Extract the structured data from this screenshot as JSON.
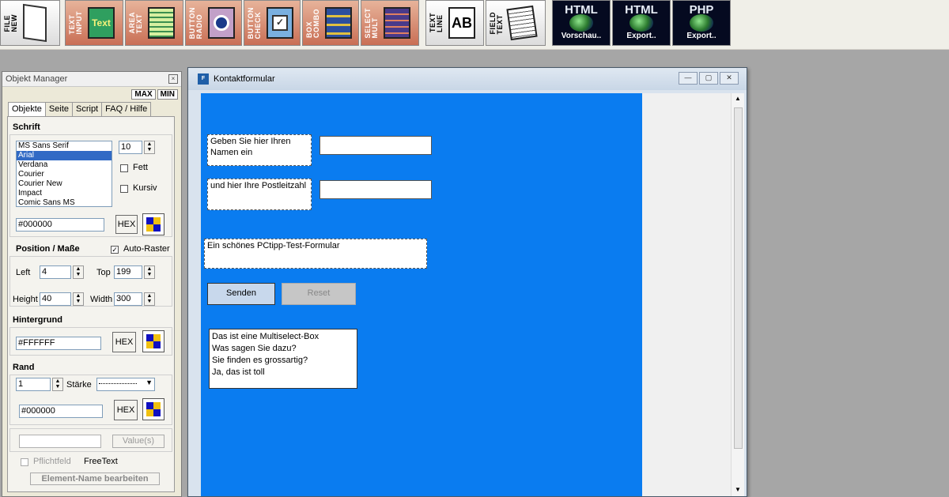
{
  "toolbar": {
    "buttons": [
      {
        "label": "FILE\nNEW",
        "icon": "file-new-icon"
      },
      {
        "label": "TEXT\nINPUT",
        "icon": "text-input-icon",
        "icon_text": "Text"
      },
      {
        "label": "AREA\nTEXT",
        "icon": "text-area-icon"
      },
      {
        "label": "BUTTON\nRADIO",
        "icon": "radio-button-icon"
      },
      {
        "label": "BUTTON\nCHECK",
        "icon": "checkbox-icon"
      },
      {
        "label": "BOX\nCOMBO",
        "icon": "combo-box-icon"
      },
      {
        "label": "SELECT\nMULT",
        "icon": "multi-select-icon"
      },
      {
        "label": "TEXT\nLINE",
        "icon": "text-line-icon",
        "icon_text": "AB"
      },
      {
        "label": "FIELD\nTEXT",
        "icon": "text-field-icon"
      }
    ],
    "actions": [
      {
        "big": "HTML",
        "small": "Vorschau..",
        "icon": "globe-icon"
      },
      {
        "big": "HTML",
        "small": "Export..",
        "icon": "globe-icon"
      },
      {
        "big": "PHP",
        "small": "Export..",
        "icon": "globe-icon"
      }
    ]
  },
  "objmgr": {
    "title": "Objekt Manager",
    "max": "MAX",
    "min": "MIN",
    "tabs": [
      "Objekte",
      "Seite",
      "Script",
      "FAQ / Hilfe"
    ],
    "font": {
      "heading": "Schrift",
      "list": [
        "MS Sans Serif",
        "Arial",
        "Verdana",
        "Courier",
        "Courier New",
        "Impact",
        "Comic Sans MS"
      ],
      "selected": "Arial",
      "size": "10",
      "bold_label": "Fett",
      "italic_label": "Kursiv",
      "color": "#000000",
      "hex_label": "HEX"
    },
    "position": {
      "heading": "Position / Maße",
      "autoraster_label": "Auto-Raster",
      "left_label": "Left",
      "left": "4",
      "top_label": "Top",
      "top": "199",
      "height_label": "Height",
      "height": "40",
      "width_label": "Width",
      "width": "300"
    },
    "background": {
      "heading": "Hintergrund",
      "color": "#FFFFFF",
      "hex_label": "HEX"
    },
    "border": {
      "heading": "Rand",
      "width": "1",
      "strength_label": "Stärke",
      "color": "#000000",
      "hex_label": "HEX"
    },
    "values_label": "Value(s)",
    "required_label": "Pflichtfeld",
    "freetext_label": "FreeText",
    "rename_label": "Element-Name bearbeiten"
  },
  "formwin": {
    "title": "Kontaktformular",
    "labels": {
      "name": "Geben Sie hier Ihren Namen ein",
      "zip": "und hier Ihre Postleitzahl",
      "textarea": "Ein schönes PCtipp-Test-Formular"
    },
    "buttons": {
      "submit": "Senden",
      "reset": "Reset"
    },
    "multiselect": [
      "Das ist eine Multiselect-Box",
      "Was sagen Sie dazu?",
      "Sie finden es grossartig?",
      "Ja, das ist toll"
    ]
  },
  "colors": {
    "canvas": "#0a7cf0",
    "toolbar_button": "#c96f55",
    "selection": "#316ac5"
  }
}
